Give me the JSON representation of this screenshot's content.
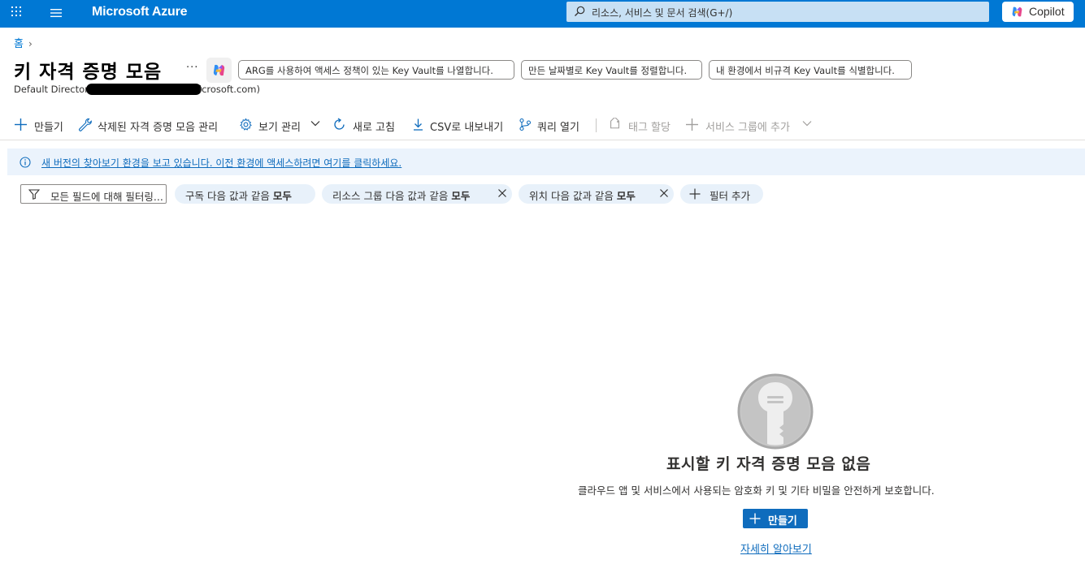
{
  "topbar": {
    "brand": "Microsoft Azure",
    "search_placeholder": "리소스, 서비스 및 문서 검색(G+/)",
    "copilot_label": "Copilot"
  },
  "breadcrumb": {
    "home": "홈",
    "separator": "›"
  },
  "page": {
    "title": "키 자격 증명 모음",
    "more": "···",
    "subtitle_prefix": "Default Director",
    "subtitle_suffix": "icrosoft.com)"
  },
  "suggestions": [
    "ARG를 사용하여 액세스 정책이 있는 Key Vault를 나열합니다.",
    "만든 날짜별로 Key Vault를 정렬합니다.",
    "내 환경에서 비규격 Key Vault를 식별합니다."
  ],
  "commands": {
    "create": "만들기",
    "manage_deleted": "삭제된 자격 증명 모음 관리",
    "manage_view": "보기 관리",
    "refresh": "새로 고침",
    "export_csv": "CSV로 내보내기",
    "open_query": "쿼리 열기",
    "assign_tags": "태그 할당",
    "add_to_service_group": "서비스 그룹에 추가"
  },
  "banner": {
    "message": "새 버전의 찾아보기 환경을 보고 있습니다. 이전 환경에 액세스하려면 여기를 클릭하세요."
  },
  "filters": {
    "placeholder": "모든 필드에 대해 필터링...",
    "subscription": {
      "label": "구독 다음 값과 같음 ",
      "value": "모두"
    },
    "resource_group": {
      "label": "리소스 그룹 다음 값과 같음 ",
      "value": "모두"
    },
    "location": {
      "label": "위치 다음 값과 같음 ",
      "value": "모두"
    },
    "add_filter": "필터 추가"
  },
  "empty_state": {
    "title": "표시할 키 자격 증명 모음 없음",
    "description": "클라우드 앱 및 서비스에서 사용되는 암호화 키 및 기타 비밀을 안전하게 보호합니다.",
    "create_button": "만들기",
    "learn_more": "자세히 알아보기"
  },
  "colors": {
    "azure_blue": "#0078d4",
    "link": "#0f6cbd",
    "banner_bg": "#ebf3fc",
    "pill_bg": "#e8f1fa"
  }
}
